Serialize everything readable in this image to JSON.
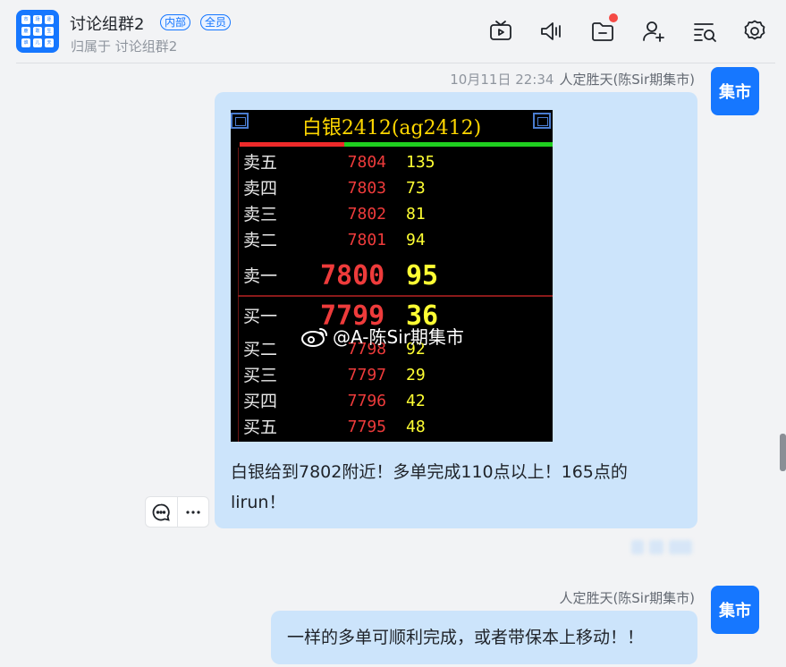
{
  "header": {
    "group_name": "讨论组群2",
    "tag_internal": "内部",
    "tag_all": "全员",
    "subtitle": "归属于 讨论组群2",
    "avatar_cells": [
      "市",
      "场",
      "逐",
      "鹿",
      "敢",
      "生",
      "谁",
      "儿",
      "天"
    ],
    "icons": [
      "tv-icon",
      "speaker-icon",
      "folder-icon",
      "add-member-icon",
      "search-list-icon",
      "gear-icon"
    ]
  },
  "messages": [
    {
      "time": "10月11日 22:34",
      "sender": "人定胜天(陈Sir期集市)",
      "avatar_text": "集市",
      "quote_image": {
        "title": "白银2412(ag2412)",
        "asks": [
          {
            "label": "卖五",
            "price": "7804",
            "volume": "135"
          },
          {
            "label": "卖四",
            "price": "7803",
            "volume": "73"
          },
          {
            "label": "卖三",
            "price": "7802",
            "volume": "81"
          },
          {
            "label": "卖二",
            "price": "7801",
            "volume": "94"
          },
          {
            "label": "卖一",
            "price": "7800",
            "volume": "95"
          }
        ],
        "bids": [
          {
            "label": "买一",
            "price": "7799",
            "volume": "36"
          },
          {
            "label": "买二",
            "price": "7798",
            "volume": "92"
          },
          {
            "label": "买三",
            "price": "7797",
            "volume": "29"
          },
          {
            "label": "买四",
            "price": "7796",
            "volume": "42"
          },
          {
            "label": "买五",
            "price": "7795",
            "volume": "48"
          }
        ],
        "watermark": "@A-陈Sir期集市"
      },
      "text_line1": "白银给到7802附近！多单完成110点以上！165点的",
      "text_line2": "lirun！"
    },
    {
      "sender": "人定胜天(陈Sir期集市)",
      "avatar_text": "集市",
      "text": "一样的多单可顺利完成，或者带保本上移动！！"
    }
  ],
  "colors": {
    "accent": "#1677ff",
    "bubble": "#cce4fb",
    "background": "#f2f3f5",
    "notify_dot": "#f54a45"
  }
}
